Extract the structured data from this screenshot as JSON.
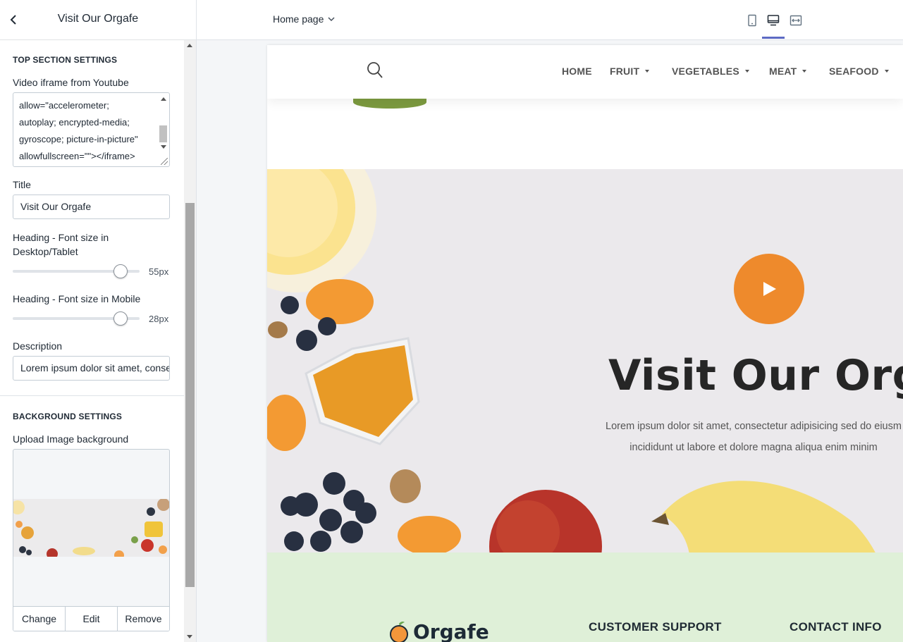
{
  "sidebar": {
    "title": "Visit Our Orgafe",
    "top_section": {
      "heading": "TOP SECTION SETTINGS",
      "iframe_label": "Video iframe from Youtube",
      "iframe_value": "allow=\"accelerometer;\nautoplay; encrypted-media;\ngyroscope; picture-in-picture\"\nallowfullscreen=\"\"></iframe>",
      "title_label": "Title",
      "title_value": "Visit Our Orgafe",
      "heading_desktop_label": "Heading - Font size in Desktop/Tablet",
      "heading_desktop_value": "55px",
      "heading_desktop_level": 0.85,
      "heading_mobile_label": "Heading - Font size in Mobile",
      "heading_mobile_value": "28px",
      "heading_mobile_level": 0.85,
      "description_label": "Description",
      "description_value": "Lorem ipsum dolor sit amet, consectetur"
    },
    "background": {
      "heading": "BACKGROUND SETTINGS",
      "upload_label": "Upload Image background",
      "change_label": "Change",
      "edit_label": "Edit",
      "remove_label": "Remove"
    }
  },
  "toolbar": {
    "page_select": "Home page",
    "views": [
      "mobile-view-icon",
      "desktop-view-icon",
      "fullwidth-view-icon"
    ],
    "active_view": "desktop",
    "accent": "#5c6ac4"
  },
  "preview": {
    "nav": {
      "items": [
        {
          "label": "HOME",
          "dropdown": false
        },
        {
          "label": "FRUIT",
          "dropdown": true
        },
        {
          "label": "VEGETABLES",
          "dropdown": true
        },
        {
          "label": "MEAT",
          "dropdown": true
        },
        {
          "label": "SEAFOOD",
          "dropdown": true
        }
      ]
    },
    "hero": {
      "title": "Visit Our Orgafe",
      "desc_line1": "Lorem ipsum dolor sit amet, consectetur adipisicing sed do eiusm",
      "desc_line2": "incididunt ut labore et dolore magna aliqua enim minim",
      "play_color": "#ee8a2c"
    },
    "footer": {
      "logo_text": "Orgafe",
      "customer_support": "CUSTOMER SUPPORT",
      "contact_info": "CONTACT INFO",
      "bg": "#dff0d8"
    }
  }
}
